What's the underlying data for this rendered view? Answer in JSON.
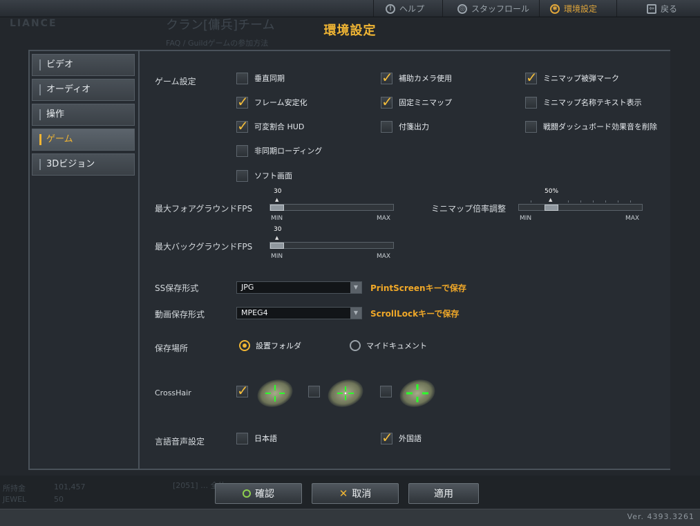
{
  "topbar": {
    "help": "ヘルプ",
    "staffroll": "スタッフロール",
    "settings": "環境設定",
    "back": "戻る"
  },
  "background": {
    "logo": "LIANCE",
    "clan_title": "クラン[傭兵]チーム",
    "clan_sub": "FAQ / Guildゲームの参加方法",
    "stat1_label": "所持金",
    "stat1_value": "101,457",
    "stat2_label": "JEWEL",
    "stat2_value": "50",
    "chat": "[2051] … 全体"
  },
  "title": "環境設定",
  "sidebar": {
    "items": [
      {
        "label": "ビデオ",
        "active": false
      },
      {
        "label": "オーディオ",
        "active": false
      },
      {
        "label": "操作",
        "active": false
      },
      {
        "label": "ゲーム",
        "active": true
      },
      {
        "label": "3Dビジョン",
        "active": false
      }
    ]
  },
  "game_settings": {
    "label": "ゲーム設定",
    "options": [
      {
        "label": "垂直同期",
        "checked": false
      },
      {
        "label": "補助カメラ使用",
        "checked": true
      },
      {
        "label": "ミニマップ被弾マーク",
        "checked": true
      },
      {
        "label": "フレーム安定化",
        "checked": true
      },
      {
        "label": "固定ミニマップ",
        "checked": true
      },
      {
        "label": "ミニマップ名称テキスト表示",
        "checked": false
      },
      {
        "label": "可変割合 HUD",
        "checked": true
      },
      {
        "label": "付箋出力",
        "checked": false
      },
      {
        "label": "戦闘ダッシュボード効果音を削除",
        "checked": false
      },
      {
        "label": "非同期ローディング",
        "checked": false
      },
      {
        "label": "ソフト画面",
        "checked": false
      }
    ]
  },
  "sliders": {
    "fg_fps": {
      "label": "最大フォアグラウンドFPS",
      "value": "30",
      "fraction": 0.0,
      "min": "MIN",
      "max": "MAX"
    },
    "bg_fps": {
      "label": "最大バックグラウンドFPS",
      "value": "30",
      "fraction": 0.0,
      "min": "MIN",
      "max": "MAX"
    },
    "minimap_zoom": {
      "label": "ミニマップ倍率調整",
      "value": "50%",
      "fraction": 0.25,
      "min": "MIN",
      "max": "MAX"
    }
  },
  "ss_format": {
    "label": "SS保存形式",
    "value": "JPG",
    "hint": "PrintScreenキーで保存"
  },
  "video_format": {
    "label": "動画保存形式",
    "value": "MPEG4",
    "hint": "ScrollLockキーで保存"
  },
  "save_location": {
    "label": "保存場所",
    "options": [
      {
        "label": "設置フォルダ",
        "selected": true
      },
      {
        "label": "マイドキュメント",
        "selected": false
      }
    ]
  },
  "crosshair": {
    "label": "CrossHair",
    "options": [
      {
        "checked": true
      },
      {
        "checked": false
      },
      {
        "checked": false
      }
    ],
    "color": "#2bff2b"
  },
  "voice": {
    "label": "言語音声設定",
    "options": [
      {
        "label": "日本語",
        "checked": false
      },
      {
        "label": "外国語",
        "checked": true
      }
    ]
  },
  "buttons": {
    "confirm": "確認",
    "cancel": "取消",
    "apply": "適用"
  },
  "version": "Ver. 4393.3261",
  "colors": {
    "accent": "#f0b534",
    "hint": "#f0a828"
  }
}
